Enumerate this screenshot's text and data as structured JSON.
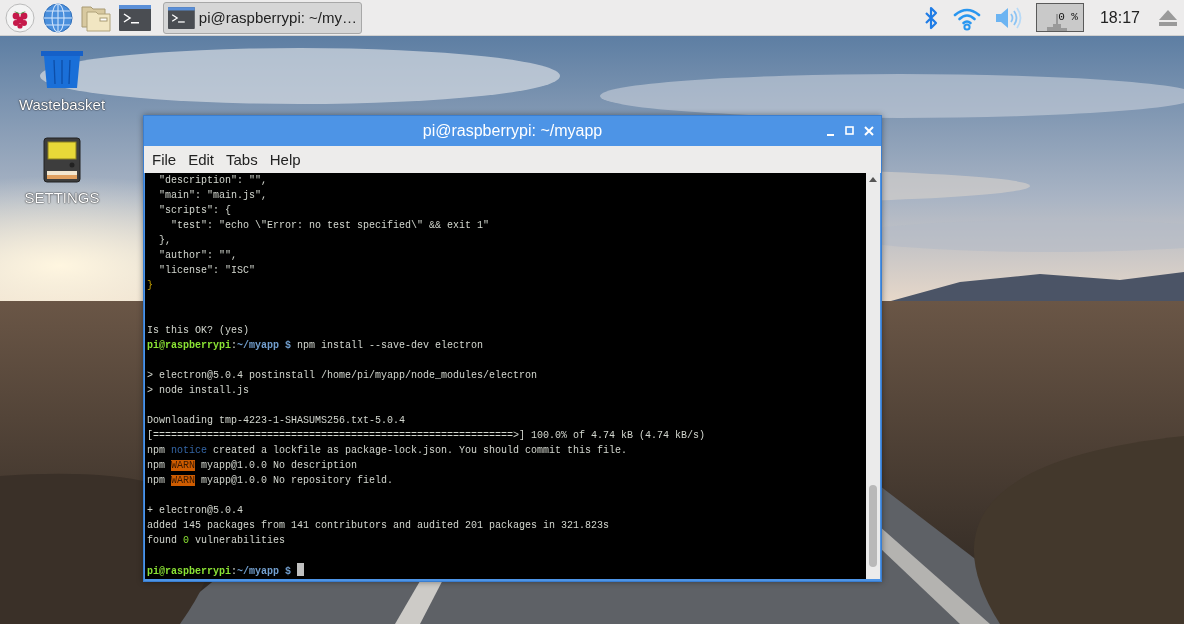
{
  "panel": {
    "task_button": {
      "label": "pi@raspberrypi: ~/my…",
      "selected": true
    },
    "cpu_monitor": "0 %",
    "clock": "18:17"
  },
  "desktop_icons": [
    {
      "label": "Wastebasket",
      "kind": "trash"
    },
    {
      "label": "SETTINGS",
      "kind": "settings"
    }
  ],
  "terminal": {
    "title": "pi@raspberrypi: ~/myapp",
    "menu": [
      "File",
      "Edit",
      "Tabs",
      "Help"
    ],
    "lines": [
      {
        "kind": "text",
        "segments": [
          {
            "kind": "plain",
            "text": "  \"description\": \"\","
          }
        ]
      },
      {
        "kind": "text",
        "segments": [
          {
            "kind": "plain",
            "text": "  \"main\": \"main.js\","
          }
        ]
      },
      {
        "kind": "text",
        "segments": [
          {
            "kind": "plain",
            "text": "  \"scripts\": {"
          }
        ]
      },
      {
        "kind": "text",
        "segments": [
          {
            "kind": "plain",
            "text": "    \"test\": \"echo \\\"Error: no test specified\\\" && exit 1\""
          }
        ]
      },
      {
        "kind": "text",
        "segments": [
          {
            "kind": "plain",
            "text": "  },"
          }
        ]
      },
      {
        "kind": "text",
        "segments": [
          {
            "kind": "plain",
            "text": "  \"author\": \"\","
          }
        ]
      },
      {
        "kind": "text",
        "segments": [
          {
            "kind": "plain",
            "text": "  \"license\": \"ISC\""
          }
        ]
      },
      {
        "kind": "text",
        "segments": [
          {
            "kind": "yellow",
            "text": "}"
          }
        ]
      },
      {
        "kind": "blank"
      },
      {
        "kind": "blank"
      },
      {
        "kind": "text",
        "segments": [
          {
            "kind": "plain",
            "text": "Is this OK? (yes)"
          }
        ]
      },
      {
        "kind": "text",
        "segments": [
          {
            "kind": "user",
            "text": "pi@raspberrypi"
          },
          {
            "kind": "plain",
            "text": ":"
          },
          {
            "kind": "path",
            "text": "~/myapp $"
          },
          {
            "kind": "plain",
            "text": " npm install --save-dev electron"
          }
        ]
      },
      {
        "kind": "blank"
      },
      {
        "kind": "text",
        "segments": [
          {
            "kind": "plain",
            "text": "> electron@5.0.4 postinstall /home/pi/myapp/node_modules/electron"
          }
        ]
      },
      {
        "kind": "text",
        "segments": [
          {
            "kind": "plain",
            "text": "> node install.js"
          }
        ]
      },
      {
        "kind": "blank"
      },
      {
        "kind": "text",
        "segments": [
          {
            "kind": "plain",
            "text": "Downloading tmp-4223-1-SHASUMS256.txt-5.0.4"
          }
        ]
      },
      {
        "kind": "text",
        "segments": [
          {
            "kind": "plain",
            "text": "[============================================================>] 100.0% of 4.74 kB (4.74 kB/s)"
          }
        ]
      },
      {
        "kind": "text",
        "segments": [
          {
            "kind": "plain",
            "text": "npm "
          },
          {
            "kind": "notice",
            "text": "notice"
          },
          {
            "kind": "plain",
            "text": " created a lockfile as package-lock.json. You should commit this file."
          }
        ]
      },
      {
        "kind": "text",
        "segments": [
          {
            "kind": "plain",
            "text": "npm "
          },
          {
            "kind": "warn",
            "text": "WARN"
          },
          {
            "kind": "plain",
            "text": " myapp@1.0.0 No description"
          }
        ]
      },
      {
        "kind": "text",
        "segments": [
          {
            "kind": "plain",
            "text": "npm "
          },
          {
            "kind": "warn",
            "text": "WARN"
          },
          {
            "kind": "plain",
            "text": " myapp@1.0.0 No repository field."
          }
        ]
      },
      {
        "kind": "blank"
      },
      {
        "kind": "text",
        "segments": [
          {
            "kind": "plain",
            "text": "+ electron@5.0.4"
          }
        ]
      },
      {
        "kind": "text",
        "segments": [
          {
            "kind": "plain",
            "text": "added 145 packages from 141 contributors and audited 201 packages in 321.823s"
          }
        ]
      },
      {
        "kind": "text",
        "segments": [
          {
            "kind": "plain",
            "text": "found "
          },
          {
            "kind": "green",
            "text": "0"
          },
          {
            "kind": "plain",
            "text": " vulnerabilities"
          }
        ]
      },
      {
        "kind": "blank"
      },
      {
        "kind": "text",
        "cursor": true,
        "segments": [
          {
            "kind": "user",
            "text": "pi@raspberrypi"
          },
          {
            "kind": "plain",
            "text": ":"
          },
          {
            "kind": "path",
            "text": "~/myapp $"
          }
        ]
      }
    ]
  }
}
